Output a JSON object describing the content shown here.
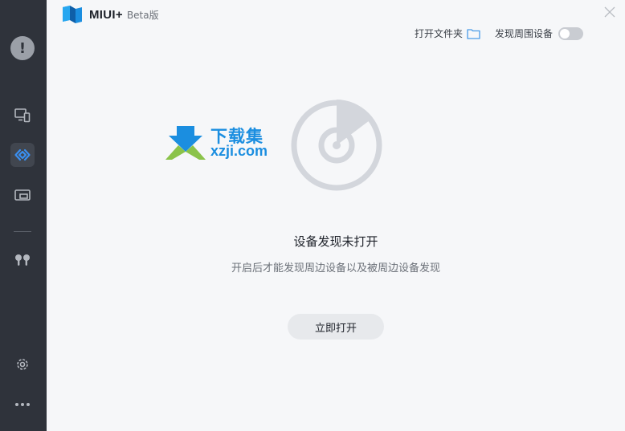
{
  "app": {
    "name": "MIUI+",
    "badge": "Beta版"
  },
  "toolbar": {
    "open_folder_label": "打开文件夹",
    "discover_label": "发现周围设备",
    "discover_enabled": false
  },
  "watermark": {
    "title": "下载集",
    "subtitle": "xzji.com"
  },
  "empty_state": {
    "heading": "设备发现未打开",
    "description": "开启后才能发现周边设备以及被周边设备发现",
    "button_label": "立即打开"
  },
  "sidebar": {
    "items": [
      {
        "icon": "alert-icon"
      },
      {
        "icon": "devices-icon"
      },
      {
        "icon": "nearby-share-icon",
        "active": true
      },
      {
        "icon": "screen-cast-icon"
      },
      {
        "icon": "earbuds-icon"
      },
      {
        "icon": "settings-icon"
      },
      {
        "icon": "more-icon"
      }
    ]
  },
  "colors": {
    "sidebar_bg": "#2f333b",
    "accent": "#1b8ee0",
    "main_bg": "#f6f7f9",
    "radar": "#d3d6dc"
  }
}
